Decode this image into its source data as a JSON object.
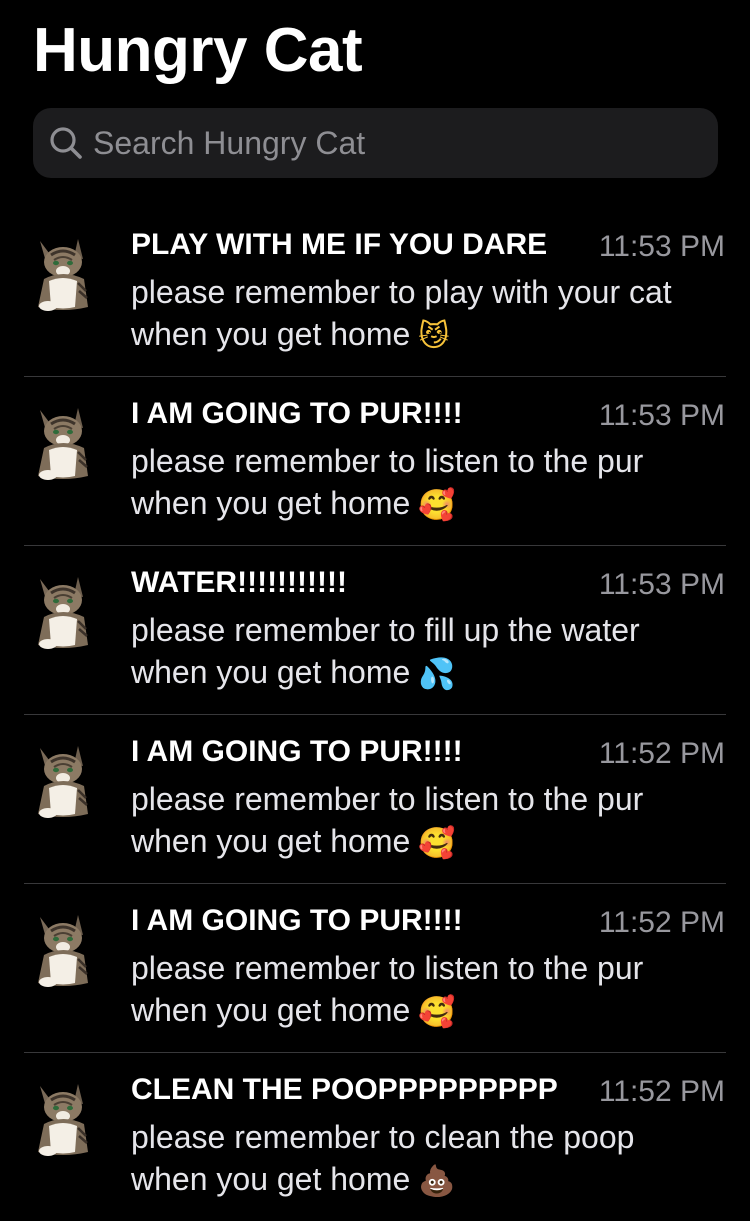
{
  "header": {
    "title": "Hungry Cat"
  },
  "search": {
    "placeholder": "Search Hungry Cat"
  },
  "messages": [
    {
      "sender": "PLAY WITH ME IF YOU DARE",
      "time": "11:53 PM",
      "line1": "please remember to play with your cat",
      "line2": "when you get home",
      "emoji": "😼",
      "emoji_icon": "smirking-cat-icon",
      "emoji_color": "#f7c33a"
    },
    {
      "sender": "I AM GOING TO PUR!!!!",
      "time": "11:53 PM",
      "line1": "please remember to listen to the pur",
      "line2": "when you get home",
      "emoji": "🥰",
      "emoji_icon": "smiling-face-with-hearts-icon",
      "emoji_color": "#f7b733"
    },
    {
      "sender": "WATER!!!!!!!!!!!",
      "time": "11:53 PM",
      "line1": "please remember to fill up the water",
      "line2": "when you get home",
      "emoji": "💦",
      "emoji_icon": "sweat-droplets-icon",
      "emoji_color": "#4aa3e8"
    },
    {
      "sender": "I AM GOING TO PUR!!!!",
      "time": "11:52 PM",
      "line1": "please remember to listen to the pur",
      "line2": "when you get home",
      "emoji": "🥰",
      "emoji_icon": "smiling-face-with-hearts-icon",
      "emoji_color": "#f7b733"
    },
    {
      "sender": "I AM GOING TO PUR!!!!",
      "time": "11:52 PM",
      "line1": "please remember to listen to the pur",
      "line2": "when you get home",
      "emoji": "🥰",
      "emoji_icon": "smiling-face-with-hearts-icon",
      "emoji_color": "#f7b733"
    },
    {
      "sender": "CLEAN THE POOPPPPPPPPP",
      "time": "11:52 PM",
      "line1": "please remember to clean the poop",
      "line2": "when you get home",
      "emoji": "💩",
      "emoji_icon": "pile-of-poo-icon",
      "emoji_color": "#8d5a3b"
    }
  ],
  "colors": {
    "background": "#000000",
    "search_field": "#1c1c1e",
    "secondary_text": "#98989e",
    "separator": "#38383a"
  }
}
